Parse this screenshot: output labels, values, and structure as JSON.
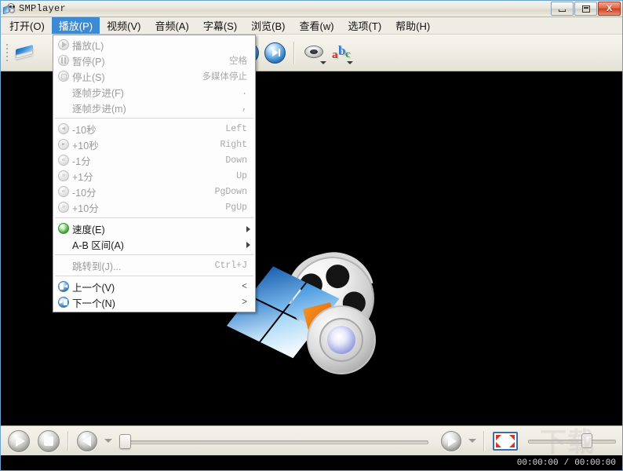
{
  "window": {
    "title": "SMPlayer",
    "icon": "smplayer-logo-icon",
    "buttons": {
      "minimize": "minimize-button",
      "maximize": "maximize-button",
      "close": "close-button",
      "close_glyph": "X"
    }
  },
  "menubar": {
    "items": [
      {
        "label": "打开(O)",
        "name": "menu-open",
        "active": false
      },
      {
        "label": "播放(P)",
        "name": "menu-play",
        "active": true
      },
      {
        "label": "视频(V)",
        "name": "menu-video",
        "active": false
      },
      {
        "label": "音频(A)",
        "name": "menu-audio",
        "active": false
      },
      {
        "label": "字幕(S)",
        "name": "menu-subtitles",
        "active": false
      },
      {
        "label": "浏览(B)",
        "name": "menu-browse",
        "active": false
      },
      {
        "label": "查看(w)",
        "name": "menu-view",
        "active": false
      },
      {
        "label": "选项(T)",
        "name": "menu-options",
        "active": false
      },
      {
        "label": "帮助(H)",
        "name": "menu-help",
        "active": false
      }
    ]
  },
  "toolbar": {
    "open_icon": "open-file-icon",
    "settings_icon": "screwdriver-settings-icon",
    "prev_icon": "previous-track-icon",
    "next_icon": "next-track-icon",
    "audio_track_icon": "audio-track-icon",
    "subtitle_icon": "subtitle-abc-icon"
  },
  "play_menu": {
    "groups": [
      {
        "items": [
          {
            "label": "播放(L)",
            "shortcut": "",
            "enabled": false,
            "icon": "play-icon",
            "submenu": false
          },
          {
            "label": "暂停(P)",
            "shortcut": "空格",
            "enabled": false,
            "icon": "pause-icon",
            "submenu": false
          },
          {
            "label": "停止(S)",
            "shortcut": "多媒体停止",
            "enabled": false,
            "icon": "stop-icon",
            "submenu": false
          },
          {
            "label": "逐帧步进(F)",
            "shortcut": ".",
            "enabled": false,
            "icon": "none",
            "submenu": false
          },
          {
            "label": "逐帧步进(m)",
            "shortcut": ",",
            "enabled": false,
            "icon": "none",
            "submenu": false
          }
        ]
      },
      {
        "items": [
          {
            "label": "-10秒",
            "shortcut": "Left",
            "enabled": false,
            "icon": "seek-back-small-icon",
            "submenu": false
          },
          {
            "label": "+10秒",
            "shortcut": "Right",
            "enabled": false,
            "icon": "seek-fwd-small-icon",
            "submenu": false
          },
          {
            "label": "-1分",
            "shortcut": "Down",
            "enabled": false,
            "icon": "seek-back-medium-icon",
            "submenu": false
          },
          {
            "label": "+1分",
            "shortcut": "Up",
            "enabled": false,
            "icon": "seek-fwd-medium-icon",
            "submenu": false
          },
          {
            "label": "-10分",
            "shortcut": "PgDown",
            "enabled": false,
            "icon": "seek-back-large-icon",
            "submenu": false
          },
          {
            "label": "+10分",
            "shortcut": "PgUp",
            "enabled": false,
            "icon": "seek-fwd-large-icon",
            "submenu": false
          }
        ]
      },
      {
        "items": [
          {
            "label": "速度(E)",
            "shortcut": "",
            "enabled": true,
            "icon": "speed-icon",
            "submenu": true
          },
          {
            "label": "A-B 区间(A)",
            "shortcut": "",
            "enabled": true,
            "icon": "none",
            "submenu": true
          }
        ]
      },
      {
        "items": [
          {
            "label": "跳转到(J)...",
            "shortcut": "Ctrl+J",
            "enabled": false,
            "icon": "none",
            "submenu": false
          }
        ]
      },
      {
        "items": [
          {
            "label": "上一个(V)",
            "shortcut": "<",
            "enabled": true,
            "icon": "previous-icon",
            "submenu": false
          },
          {
            "label": "下一个(N)",
            "shortcut": ">",
            "enabled": true,
            "icon": "next-icon",
            "submenu": false
          }
        ]
      }
    ]
  },
  "video": {
    "logo": "smplayer-logo"
  },
  "controls": {
    "play_button": "play-button",
    "stop_button": "stop-button",
    "rewind_button": "rewind-button",
    "forward_button": "forward-button",
    "fullscreen_button": "fullscreen-button",
    "seek_slider": "seek-slider",
    "volume_slider": "volume-slider",
    "seek_value": 0,
    "volume_value": 60
  },
  "status": {
    "current_time": "00:00:00",
    "separator": "/",
    "total_time": "00:00:00"
  },
  "watermark": {
    "text": "下载"
  },
  "colors": {
    "menu_highlight": "#3d8ad4",
    "chrome": "#eceade",
    "video_background": "#000000",
    "close_button": "#cb4024"
  }
}
